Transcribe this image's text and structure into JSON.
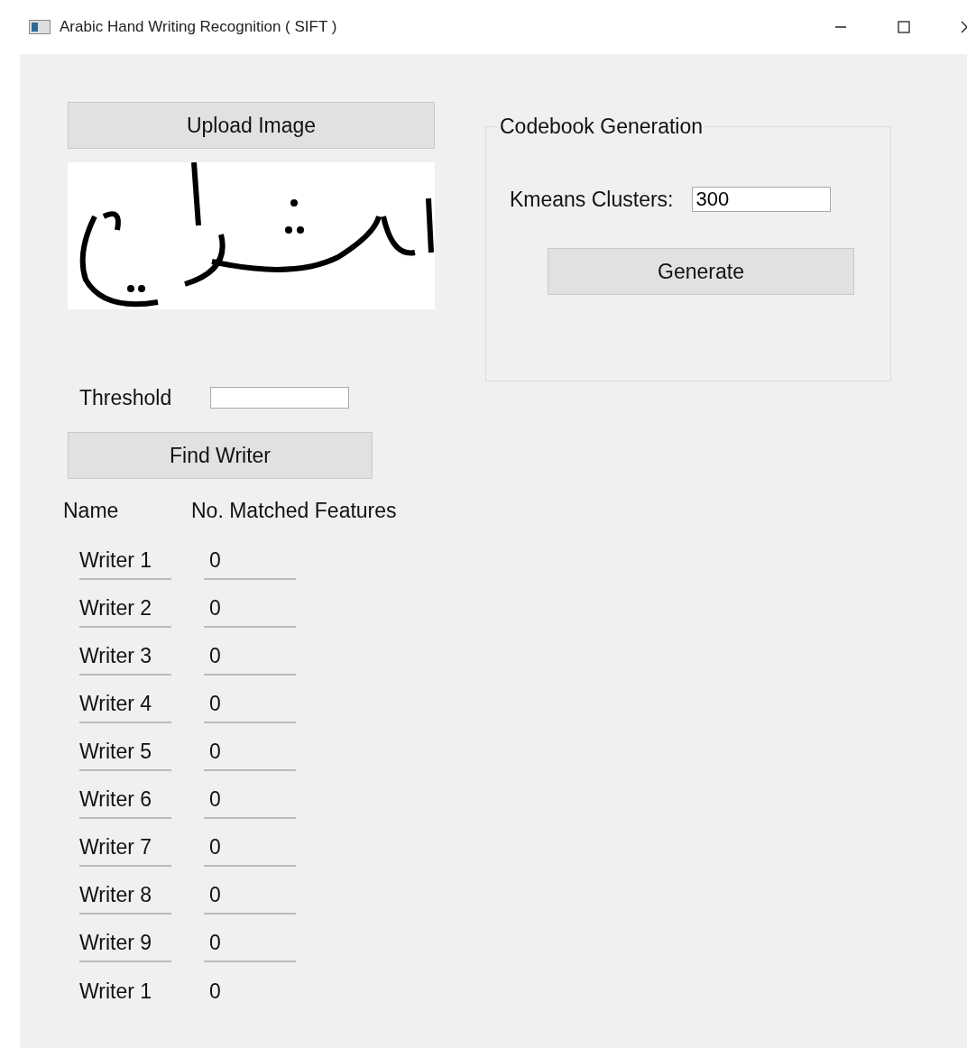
{
  "window": {
    "title": "Arabic Hand Writing Recognition ( SIFT )"
  },
  "upload_button": "Upload Image",
  "threshold": {
    "label": "Threshold"
  },
  "find_button": "Find Writer",
  "table": {
    "columns": [
      "Name",
      "No. Matched Features"
    ],
    "rows": [
      {
        "name": "Writer 1",
        "matches": "0"
      },
      {
        "name": "Writer 2",
        "matches": "0"
      },
      {
        "name": "Writer 3",
        "matches": "0"
      },
      {
        "name": "Writer 4",
        "matches": "0"
      },
      {
        "name": "Writer 5",
        "matches": "0"
      },
      {
        "name": "Writer 6",
        "matches": "0"
      },
      {
        "name": "Writer 7",
        "matches": "0"
      },
      {
        "name": "Writer 8",
        "matches": "0"
      },
      {
        "name": "Writer 9",
        "matches": "0"
      },
      {
        "name": "Writer 1",
        "matches": "0"
      }
    ]
  },
  "codebook": {
    "title": "Codebook Generation",
    "kmeans_label": "Kmeans Clusters:",
    "kmeans_value": "300",
    "generate_button": "Generate"
  }
}
